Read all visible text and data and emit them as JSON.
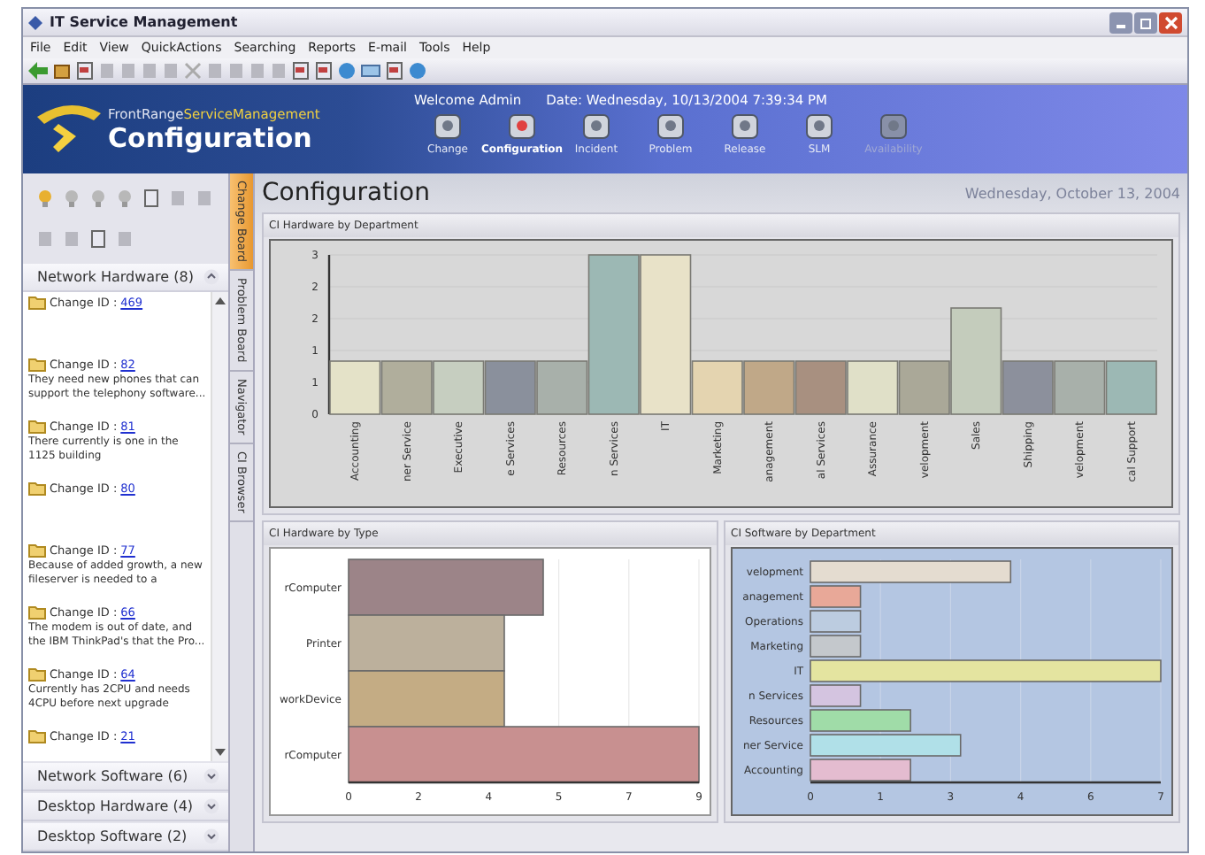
{
  "window": {
    "title": "IT Service Management"
  },
  "menu": [
    "File",
    "Edit",
    "View",
    "QuickActions",
    "Searching",
    "Reports",
    "E-mail",
    "Tools",
    "Help"
  ],
  "banner": {
    "brand": "FrontRange",
    "brand_accent": "ServiceManagement",
    "title": "Configuration",
    "welcome": "Welcome Admin",
    "date": "Date: Wednesday, 10/13/2004 7:39:34 PM",
    "nav": [
      {
        "label": "Change",
        "selected": false,
        "disabled": false
      },
      {
        "label": "Configuration",
        "selected": true,
        "disabled": false
      },
      {
        "label": "Incident",
        "selected": false,
        "disabled": false
      },
      {
        "label": "Problem",
        "selected": false,
        "disabled": false
      },
      {
        "label": "Release",
        "selected": false,
        "disabled": false
      },
      {
        "label": "SLM",
        "selected": false,
        "disabled": false
      },
      {
        "label": "Availability",
        "selected": false,
        "disabled": true
      }
    ]
  },
  "sidebar": {
    "groups": [
      {
        "title": "Network Hardware (8)",
        "expanded": true,
        "items": [
          {
            "label": "Change ID :",
            "id": "469"
          },
          {
            "label": "Change ID :",
            "id": "82",
            "description": "They need new phones that can support the telephony software..."
          },
          {
            "label": "Change ID :",
            "id": "81",
            "description": "There currently is one in the 1125 building"
          },
          {
            "label": "Change ID :",
            "id": "80"
          },
          {
            "label": "Change ID :",
            "id": "77",
            "description": "Because of added growth, a new fileserver is needed to a"
          },
          {
            "label": "Change ID :",
            "id": "66",
            "description": "The modem is out of date, and the IBM ThinkPad's that the Pro..."
          },
          {
            "label": "Change ID :",
            "id": "64",
            "description": "Currently has 2CPU and needs 4CPU before next upgrade"
          },
          {
            "label": "Change ID :",
            "id": "21"
          }
        ]
      },
      {
        "title": "Network Software (6)",
        "expanded": false
      },
      {
        "title": "Desktop Hardware (4)",
        "expanded": false
      },
      {
        "title": "Desktop Software (2)",
        "expanded": false
      }
    ]
  },
  "side_tabs": [
    {
      "label": "Change Board",
      "selected": true
    },
    {
      "label": "Problem Board",
      "selected": false
    },
    {
      "label": "Navigator",
      "selected": false
    },
    {
      "label": "CI Browser",
      "selected": false
    }
  ],
  "main": {
    "title": "Configuration",
    "date": "Wednesday, October 13, 2004",
    "panels": [
      {
        "title": "CI Hardware by Department",
        "chart_data": {
          "type": "bar",
          "orientation": "vertical",
          "categories": [
            "Accounting",
            "ner Service",
            "Executive",
            "e Services",
            "Resources",
            "n Services",
            "IT",
            "Marketing",
            "anagement",
            "al Services",
            "Assurance",
            "velopment",
            "Sales",
            "Shipping",
            "velopment",
            "cal Support"
          ],
          "values": [
            1,
            1,
            1,
            1,
            1,
            3,
            3,
            1,
            1,
            1,
            1,
            1,
            2,
            1,
            1,
            1
          ],
          "ylim": [
            0,
            3
          ],
          "grid": true,
          "yticks": [
            {
              "value": 0,
              "label": "0"
            },
            {
              "value": 0.6,
              "label": "1"
            },
            {
              "value": 1.2,
              "label": "1"
            },
            {
              "value": 1.8,
              "label": "2"
            },
            {
              "value": 2.4,
              "label": "2"
            },
            {
              "value": 3,
              "label": "3"
            }
          ]
        }
      },
      {
        "title": "CI Hardware by Type",
        "chart_data": {
          "type": "bar",
          "orientation": "horizontal",
          "categories": [
            "rComputer",
            "Printer",
            "workDevice",
            "rComputer"
          ],
          "values": [
            5,
            4,
            4,
            9
          ],
          "xlim": [
            0,
            9
          ],
          "grid": true,
          "xticks": [
            {
              "value": 0,
              "label": "0"
            },
            {
              "value": 1.8,
              "label": "2"
            },
            {
              "value": 3.6,
              "label": "4"
            },
            {
              "value": 5.4,
              "label": "5"
            },
            {
              "value": 7.2,
              "label": "7"
            },
            {
              "value": 9,
              "label": "9"
            }
          ]
        }
      },
      {
        "title": "CI Software by Department",
        "chart_data": {
          "type": "bar",
          "orientation": "horizontal",
          "categories": [
            "velopment",
            "anagement",
            "Operations",
            "Marketing",
            "IT",
            "n Services",
            "Resources",
            "ner Service",
            "Accounting"
          ],
          "values": [
            4,
            1,
            1,
            1,
            7,
            1,
            2,
            3,
            2
          ],
          "xlim": [
            0,
            7
          ],
          "grid": true,
          "xticks": [
            {
              "value": 0,
              "label": "0"
            },
            {
              "value": 1.4,
              "label": "1"
            },
            {
              "value": 2.8,
              "label": "3"
            },
            {
              "value": 4.2,
              "label": "4"
            },
            {
              "value": 5.6,
              "label": "6"
            },
            {
              "value": 7,
              "label": "7"
            }
          ]
        }
      }
    ]
  }
}
